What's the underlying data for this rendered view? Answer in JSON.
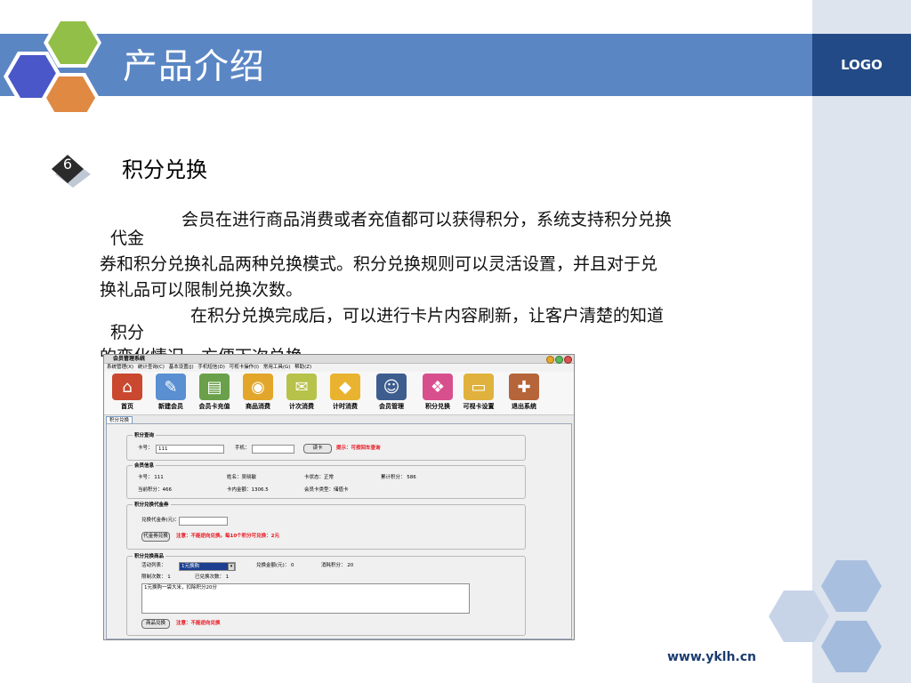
{
  "header": {
    "title": "产品介绍",
    "logo": "LOGO"
  },
  "section": {
    "number": "6",
    "title": "积分兑换"
  },
  "paragraphs": {
    "p1_line1": "会员在进行商品消费或者充值都可以获得积分，系统支持积分兑换",
    "p1_line1_sub": "代金",
    "p1_line2": "券和积分兑换礼品两种兑换模式。积分兑换规则可以灵活设置，并且对于兑",
    "p1_line3": "换礼品可以限制兑换次数。",
    "p2_line1": "在积分兑换完成后，可以进行卡片内容刷新，让客户清楚的知道",
    "p2_line1_sub": "积分",
    "p2_line2": "的变化情况，方便下次兑换。"
  },
  "footer": {
    "url": "www.yklh.cn"
  },
  "window": {
    "title": "会员管理系统",
    "menu": [
      "系统管理(X)",
      "统计查询(C)",
      "基本设置(J)",
      "手机短信(D)",
      "可视卡操作(I)",
      "常用工具(G)",
      "帮助(Z)"
    ],
    "toolbar": [
      {
        "icon": "home-icon",
        "label": "首页",
        "glyph": "⌂",
        "color": "#c9482f"
      },
      {
        "icon": "new-member-icon",
        "label": "新建会员",
        "glyph": "✎",
        "color": "#5a8fd1"
      },
      {
        "icon": "recharge-icon",
        "label": "会员卡充值",
        "glyph": "▤",
        "color": "#6aa04a"
      },
      {
        "icon": "goods-consume-icon",
        "label": "商品消费",
        "glyph": "◉",
        "color": "#e2a62a"
      },
      {
        "icon": "count-consume-icon",
        "label": "计次消费",
        "glyph": "✉",
        "color": "#b7c24a"
      },
      {
        "icon": "timed-consume-icon",
        "label": "计时消费",
        "glyph": "◆",
        "color": "#e9b32f"
      },
      {
        "icon": "member-manage-icon",
        "label": "会员管理",
        "glyph": "☺",
        "color": "#3d5d8f"
      },
      {
        "icon": "points-exchange-icon",
        "label": "积分兑换",
        "glyph": "❖",
        "color": "#d84f8d"
      },
      {
        "icon": "visible-card-icon",
        "label": "可视卡设置",
        "glyph": "▭",
        "color": "#e0b23d"
      },
      {
        "icon": "exit-icon",
        "label": "退出系统",
        "glyph": "✚",
        "color": "#b6643a"
      }
    ],
    "tab": "积分兑换",
    "query": {
      "group": "积分查询",
      "card_label": "卡号：",
      "card_value": "111",
      "phone_label": "手机：",
      "phone_value": "",
      "read_button": "读卡",
      "hint": "提示：可按回车查询"
    },
    "info": {
      "group": "会员信息",
      "card": "卡号：  111",
      "name": "姓名：吴晓敏",
      "status": "卡状态：正常",
      "total_points": "累计积分：  586",
      "current_points": "当前积分：466",
      "balance": "卡内金额：1306.5",
      "card_type": "会员卡类型：储值卡"
    },
    "voucher": {
      "group": "积分兑换代金券",
      "amount_label": "兑换代金券(元)：",
      "amount_value": "",
      "button": "代金券兑换",
      "note": "注意：不能逆向兑换。每10个积分可兑换：2元"
    },
    "goods": {
      "group": "积分兑换商品",
      "activity_label": "活动列表：",
      "activity_value": "1元换购",
      "amount_label": "兑换金额(元)：  0",
      "points_label": "消耗积分：  20",
      "limit_label": "限制次数：  1",
      "used_label": "已兑换次数：  1",
      "desc": "1元换购一袋大米，扣除积分20分",
      "button": "商品兑换",
      "note": "注意：不能逆向兑换"
    }
  }
}
